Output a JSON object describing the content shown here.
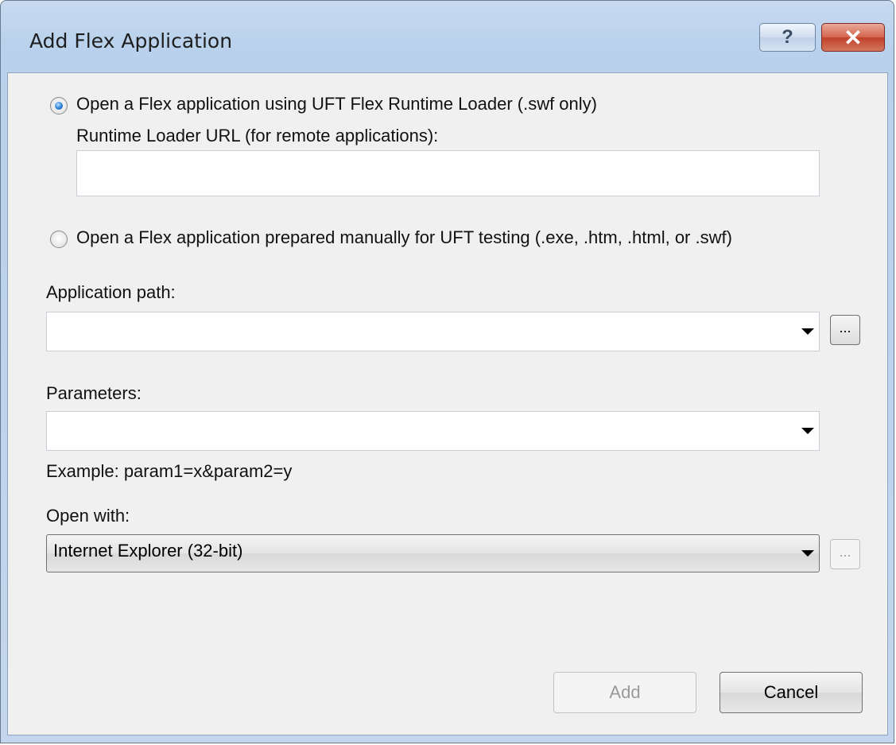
{
  "window": {
    "title": "Add Flex Application",
    "help_button": "?",
    "close_button": "✕"
  },
  "options": {
    "runtime_loader": {
      "label": "Open a Flex application using UFT Flex Runtime Loader (.swf only)",
      "selected": true,
      "url_label": "Runtime Loader URL (for remote applications):",
      "url_value": ""
    },
    "manual": {
      "label": "Open a Flex application prepared manually for UFT testing (.exe, .htm, .html, or .swf)",
      "selected": false
    }
  },
  "application_path": {
    "label": "Application path:",
    "value": "",
    "browse_label": "..."
  },
  "parameters": {
    "label": "Parameters:",
    "value": "",
    "example": "Example: param1=x&param2=y"
  },
  "open_with": {
    "label": "Open with:",
    "value": "Internet Explorer (32-bit)",
    "browse_label": "..."
  },
  "buttons": {
    "add": "Add",
    "cancel": "Cancel"
  }
}
